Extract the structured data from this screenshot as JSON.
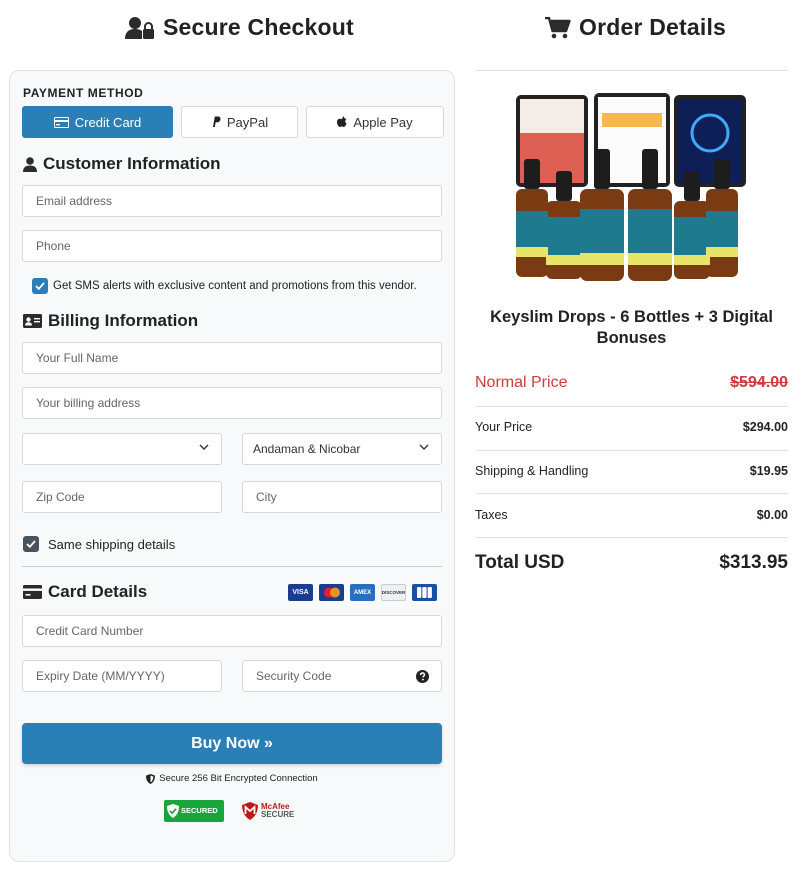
{
  "checkout": {
    "title": "Secure Checkout",
    "payment_method_label": "PAYMENT METHOD",
    "payment_tabs": [
      {
        "label": "Credit Card",
        "icon": "credit-card-icon"
      },
      {
        "label": "PayPal",
        "icon": "paypal-icon"
      },
      {
        "label": "Apple Pay",
        "icon": "apple-icon"
      }
    ],
    "customer_section": "Customer Information",
    "email_placeholder": "Email address",
    "phone_placeholder": "Phone",
    "sms_opt_in": "Get SMS alerts with exclusive content and promotions from this vendor.",
    "billing_section": "Billing Information",
    "full_name_placeholder": "Your Full Name",
    "address_placeholder": "Your billing address",
    "country_value": "",
    "state_value": "Andaman & Nicobar",
    "zip_placeholder": "Zip Code",
    "city_placeholder": "City",
    "same_shipping": "Same shipping details",
    "card_section": "Card Details",
    "card_brands": [
      "VISA",
      "Mastercard",
      "AMEX",
      "DISCOVER",
      "JCB"
    ],
    "card_number_placeholder": "Credit Card Number",
    "expiry_placeholder": "Expiry Date (MM/YYYY)",
    "cvv_placeholder": "Security Code",
    "buy_button": "Buy Now »",
    "secure_note": "Secure 256 Bit Encrypted Connection",
    "badge_secured": "SECURED",
    "badge_mcafee_brand": "McAfee",
    "badge_mcafee_secure": "SECURE"
  },
  "order": {
    "title": "Order Details",
    "product_name": "Keyslim Drops - 6 Bottles + 3 Digital Bonuses",
    "normal_price_label": "Normal Price",
    "normal_price": "$594.00",
    "rows": [
      {
        "label": "Your Price",
        "amount": "$294.00"
      },
      {
        "label": "Shipping & Handling",
        "amount": "$19.95"
      },
      {
        "label": "Taxes",
        "amount": "$0.00"
      }
    ],
    "total_label": "Total USD",
    "total": "$313.95"
  },
  "colors": {
    "primary": "#2a7fb6",
    "strike_red": "#d03b3b",
    "badge_green": "#19a53b"
  }
}
